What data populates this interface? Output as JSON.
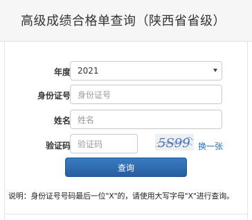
{
  "header": {
    "title": "高级成绩合格单查询（陕西省省级）"
  },
  "form": {
    "year": {
      "label": "年度",
      "value": "2021"
    },
    "id_number": {
      "label": "身份证号",
      "placeholder": "身份证号"
    },
    "name": {
      "label": "姓名",
      "placeholder": "姓名"
    },
    "captcha": {
      "label": "验证码",
      "placeholder": "验证码",
      "image_text": "5S99",
      "refresh_label": "换一张"
    },
    "submit_label": "查询"
  },
  "note": "说明：身份证号号码最后一位\"X\"的，请使用大写字母\"X\"进行查询。",
  "colors": {
    "primary": "#2d6aad",
    "link": "#2a72b8",
    "captcha_text": "#5b7fb5"
  }
}
